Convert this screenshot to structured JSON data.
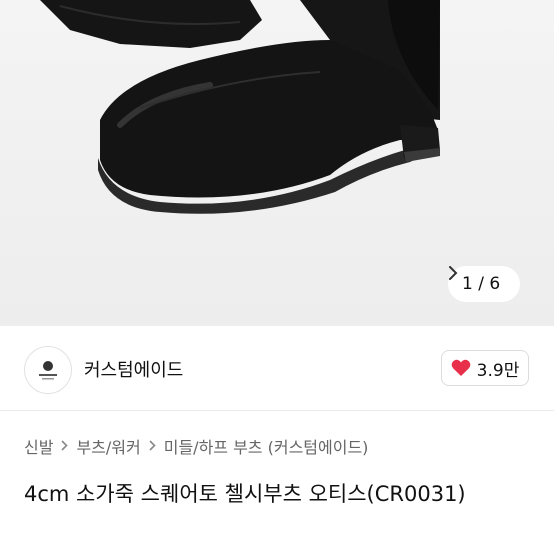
{
  "gallery": {
    "current": "1",
    "separator": "/",
    "total": "6",
    "next_icon": "chevron-right-icon"
  },
  "seller": {
    "name": "커스텀에이드",
    "avatar_icon": "store-logo-icon"
  },
  "like": {
    "count": "3.9만",
    "icon": "heart-icon",
    "color": "#e8304a"
  },
  "breadcrumb": {
    "items": [
      "신발",
      "부츠/워커",
      "미들/하프 부츠 (커스텀에이드)"
    ],
    "separator_icon": "chevron-right-icon"
  },
  "product": {
    "title": "4cm 소가죽 스퀘어토 첼시부츠 오티스(CR0031)"
  }
}
